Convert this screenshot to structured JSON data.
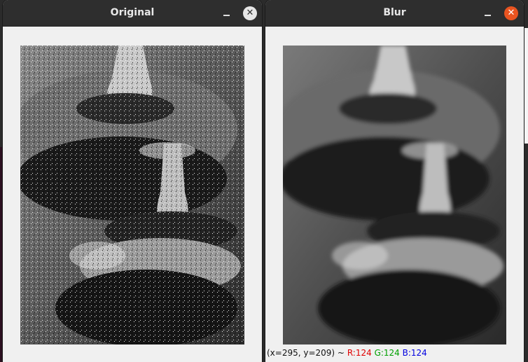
{
  "windows": {
    "original": {
      "title": "Original"
    },
    "blur": {
      "title": "Blur"
    }
  },
  "status": {
    "coords": "(x=295, y=209) ~",
    "r": "R:124",
    "g": "G:124",
    "b": "B:124"
  },
  "colors": {
    "titlebar": "#2e2e2e",
    "window_bg": "#f0f0f0",
    "close_inactive": "#e6e6e6",
    "close_active": "#e95420",
    "r": "#e00000",
    "g": "#00a000",
    "b": "#0000e0"
  },
  "icons": {
    "minimize": "minimize-icon",
    "close": "close-icon"
  }
}
